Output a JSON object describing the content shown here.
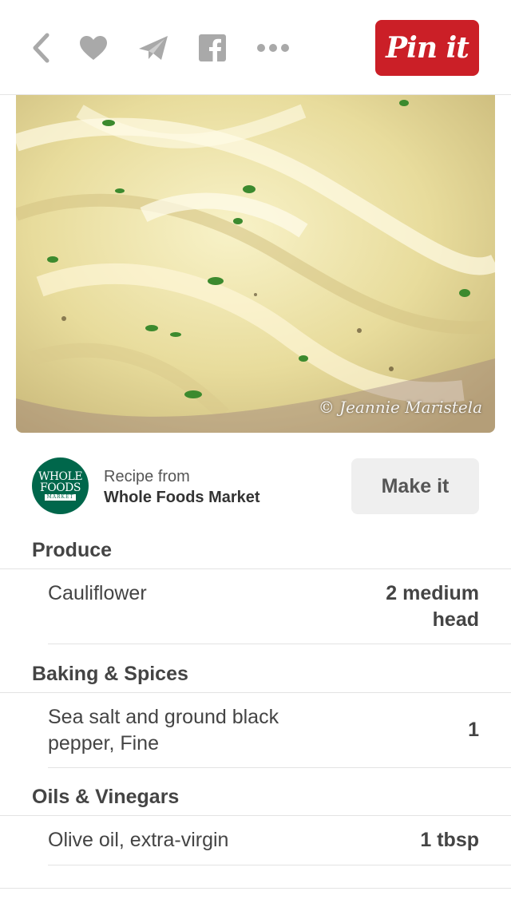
{
  "toolbar": {
    "icons": [
      "back-icon",
      "heart-icon",
      "send-icon",
      "facebook-icon",
      "more-icon"
    ],
    "pin_label": "Pin it",
    "pin_color": "#cb1f27"
  },
  "photo": {
    "subject": "mashed-cauliflower-photo",
    "watermark": "© Jeannie Maristela"
  },
  "source": {
    "logo_line1": "WHOLE",
    "logo_line2": "FOODS",
    "logo_line3": "MARKET",
    "prefix": "Recipe from",
    "name": "Whole Foods Market",
    "make_it_label": "Make it"
  },
  "sections": [
    {
      "title": "Produce",
      "items": [
        {
          "name": "Cauliflower",
          "qty_line1": "2 medium",
          "qty_line2": "head"
        }
      ]
    },
    {
      "title": "Baking & Spices",
      "items": [
        {
          "name_line1": "Sea salt and ground black",
          "name_line2": "pepper, Fine",
          "qty": "1"
        }
      ]
    },
    {
      "title": "Oils & Vinegars",
      "items": [
        {
          "name": "Olive oil, extra-virgin",
          "qty": "1 tbsp"
        }
      ]
    }
  ],
  "colors": {
    "brand_red": "#cb1f27",
    "whole_foods_green": "#00674b",
    "icon_gray": "#a9a9a9"
  }
}
